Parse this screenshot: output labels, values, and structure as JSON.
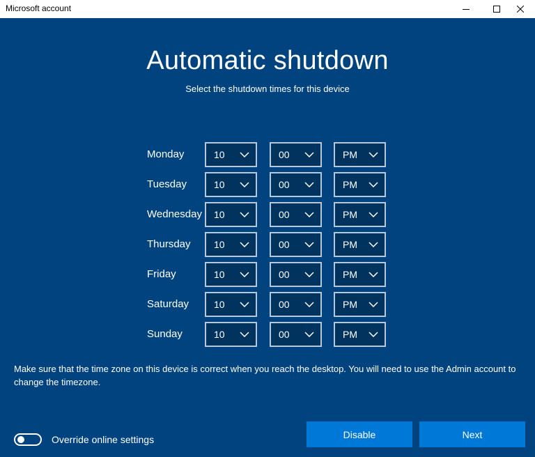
{
  "window": {
    "title": "Microsoft account"
  },
  "page": {
    "heading": "Automatic shutdown",
    "subheading": "Select the shutdown times for this device",
    "background_color": "#00437e",
    "accent_color": "#0078d7"
  },
  "schedule": [
    {
      "day": "Monday",
      "hour": "10",
      "minute": "00",
      "period": "PM"
    },
    {
      "day": "Tuesday",
      "hour": "10",
      "minute": "00",
      "period": "PM"
    },
    {
      "day": "Wednesday",
      "hour": "10",
      "minute": "00",
      "period": "PM"
    },
    {
      "day": "Thursday",
      "hour": "10",
      "minute": "00",
      "period": "PM"
    },
    {
      "day": "Friday",
      "hour": "10",
      "minute": "00",
      "period": "PM"
    },
    {
      "day": "Saturday",
      "hour": "10",
      "minute": "00",
      "period": "PM"
    },
    {
      "day": "Sunday",
      "hour": "10",
      "minute": "00",
      "period": "PM"
    }
  ],
  "note": "Make sure that the time zone on this device is correct when you reach the desktop. You will need to use the Admin account to change the timezone.",
  "override_toggle": {
    "label": "Override online settings",
    "on": false
  },
  "buttons": {
    "disable": "Disable",
    "next": "Next"
  },
  "icons": {
    "minimize": "minimize-icon",
    "maximize": "maximize-icon",
    "close": "close-icon",
    "dropdown": "chevron-down-icon"
  }
}
